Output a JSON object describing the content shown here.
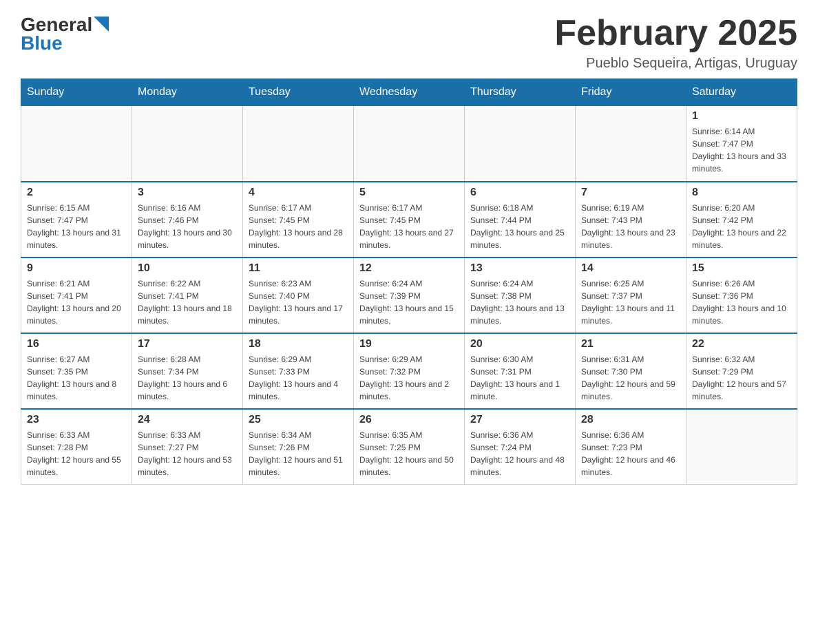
{
  "header": {
    "logo": {
      "line1": "General",
      "arrow": "▶",
      "line2": "Blue"
    },
    "title": "February 2025",
    "subtitle": "Pueblo Sequeira, Artigas, Uruguay"
  },
  "days_of_week": [
    "Sunday",
    "Monday",
    "Tuesday",
    "Wednesday",
    "Thursday",
    "Friday",
    "Saturday"
  ],
  "weeks": [
    [
      {
        "day": "",
        "sunrise": "",
        "sunset": "",
        "daylight": ""
      },
      {
        "day": "",
        "sunrise": "",
        "sunset": "",
        "daylight": ""
      },
      {
        "day": "",
        "sunrise": "",
        "sunset": "",
        "daylight": ""
      },
      {
        "day": "",
        "sunrise": "",
        "sunset": "",
        "daylight": ""
      },
      {
        "day": "",
        "sunrise": "",
        "sunset": "",
        "daylight": ""
      },
      {
        "day": "",
        "sunrise": "",
        "sunset": "",
        "daylight": ""
      },
      {
        "day": "1",
        "sunrise": "Sunrise: 6:14 AM",
        "sunset": "Sunset: 7:47 PM",
        "daylight": "Daylight: 13 hours and 33 minutes."
      }
    ],
    [
      {
        "day": "2",
        "sunrise": "Sunrise: 6:15 AM",
        "sunset": "Sunset: 7:47 PM",
        "daylight": "Daylight: 13 hours and 31 minutes."
      },
      {
        "day": "3",
        "sunrise": "Sunrise: 6:16 AM",
        "sunset": "Sunset: 7:46 PM",
        "daylight": "Daylight: 13 hours and 30 minutes."
      },
      {
        "day": "4",
        "sunrise": "Sunrise: 6:17 AM",
        "sunset": "Sunset: 7:45 PM",
        "daylight": "Daylight: 13 hours and 28 minutes."
      },
      {
        "day": "5",
        "sunrise": "Sunrise: 6:17 AM",
        "sunset": "Sunset: 7:45 PM",
        "daylight": "Daylight: 13 hours and 27 minutes."
      },
      {
        "day": "6",
        "sunrise": "Sunrise: 6:18 AM",
        "sunset": "Sunset: 7:44 PM",
        "daylight": "Daylight: 13 hours and 25 minutes."
      },
      {
        "day": "7",
        "sunrise": "Sunrise: 6:19 AM",
        "sunset": "Sunset: 7:43 PM",
        "daylight": "Daylight: 13 hours and 23 minutes."
      },
      {
        "day": "8",
        "sunrise": "Sunrise: 6:20 AM",
        "sunset": "Sunset: 7:42 PM",
        "daylight": "Daylight: 13 hours and 22 minutes."
      }
    ],
    [
      {
        "day": "9",
        "sunrise": "Sunrise: 6:21 AM",
        "sunset": "Sunset: 7:41 PM",
        "daylight": "Daylight: 13 hours and 20 minutes."
      },
      {
        "day": "10",
        "sunrise": "Sunrise: 6:22 AM",
        "sunset": "Sunset: 7:41 PM",
        "daylight": "Daylight: 13 hours and 18 minutes."
      },
      {
        "day": "11",
        "sunrise": "Sunrise: 6:23 AM",
        "sunset": "Sunset: 7:40 PM",
        "daylight": "Daylight: 13 hours and 17 minutes."
      },
      {
        "day": "12",
        "sunrise": "Sunrise: 6:24 AM",
        "sunset": "Sunset: 7:39 PM",
        "daylight": "Daylight: 13 hours and 15 minutes."
      },
      {
        "day": "13",
        "sunrise": "Sunrise: 6:24 AM",
        "sunset": "Sunset: 7:38 PM",
        "daylight": "Daylight: 13 hours and 13 minutes."
      },
      {
        "day": "14",
        "sunrise": "Sunrise: 6:25 AM",
        "sunset": "Sunset: 7:37 PM",
        "daylight": "Daylight: 13 hours and 11 minutes."
      },
      {
        "day": "15",
        "sunrise": "Sunrise: 6:26 AM",
        "sunset": "Sunset: 7:36 PM",
        "daylight": "Daylight: 13 hours and 10 minutes."
      }
    ],
    [
      {
        "day": "16",
        "sunrise": "Sunrise: 6:27 AM",
        "sunset": "Sunset: 7:35 PM",
        "daylight": "Daylight: 13 hours and 8 minutes."
      },
      {
        "day": "17",
        "sunrise": "Sunrise: 6:28 AM",
        "sunset": "Sunset: 7:34 PM",
        "daylight": "Daylight: 13 hours and 6 minutes."
      },
      {
        "day": "18",
        "sunrise": "Sunrise: 6:29 AM",
        "sunset": "Sunset: 7:33 PM",
        "daylight": "Daylight: 13 hours and 4 minutes."
      },
      {
        "day": "19",
        "sunrise": "Sunrise: 6:29 AM",
        "sunset": "Sunset: 7:32 PM",
        "daylight": "Daylight: 13 hours and 2 minutes."
      },
      {
        "day": "20",
        "sunrise": "Sunrise: 6:30 AM",
        "sunset": "Sunset: 7:31 PM",
        "daylight": "Daylight: 13 hours and 1 minute."
      },
      {
        "day": "21",
        "sunrise": "Sunrise: 6:31 AM",
        "sunset": "Sunset: 7:30 PM",
        "daylight": "Daylight: 12 hours and 59 minutes."
      },
      {
        "day": "22",
        "sunrise": "Sunrise: 6:32 AM",
        "sunset": "Sunset: 7:29 PM",
        "daylight": "Daylight: 12 hours and 57 minutes."
      }
    ],
    [
      {
        "day": "23",
        "sunrise": "Sunrise: 6:33 AM",
        "sunset": "Sunset: 7:28 PM",
        "daylight": "Daylight: 12 hours and 55 minutes."
      },
      {
        "day": "24",
        "sunrise": "Sunrise: 6:33 AM",
        "sunset": "Sunset: 7:27 PM",
        "daylight": "Daylight: 12 hours and 53 minutes."
      },
      {
        "day": "25",
        "sunrise": "Sunrise: 6:34 AM",
        "sunset": "Sunset: 7:26 PM",
        "daylight": "Daylight: 12 hours and 51 minutes."
      },
      {
        "day": "26",
        "sunrise": "Sunrise: 6:35 AM",
        "sunset": "Sunset: 7:25 PM",
        "daylight": "Daylight: 12 hours and 50 minutes."
      },
      {
        "day": "27",
        "sunrise": "Sunrise: 6:36 AM",
        "sunset": "Sunset: 7:24 PM",
        "daylight": "Daylight: 12 hours and 48 minutes."
      },
      {
        "day": "28",
        "sunrise": "Sunrise: 6:36 AM",
        "sunset": "Sunset: 7:23 PM",
        "daylight": "Daylight: 12 hours and 46 minutes."
      },
      {
        "day": "",
        "sunrise": "",
        "sunset": "",
        "daylight": ""
      }
    ]
  ]
}
